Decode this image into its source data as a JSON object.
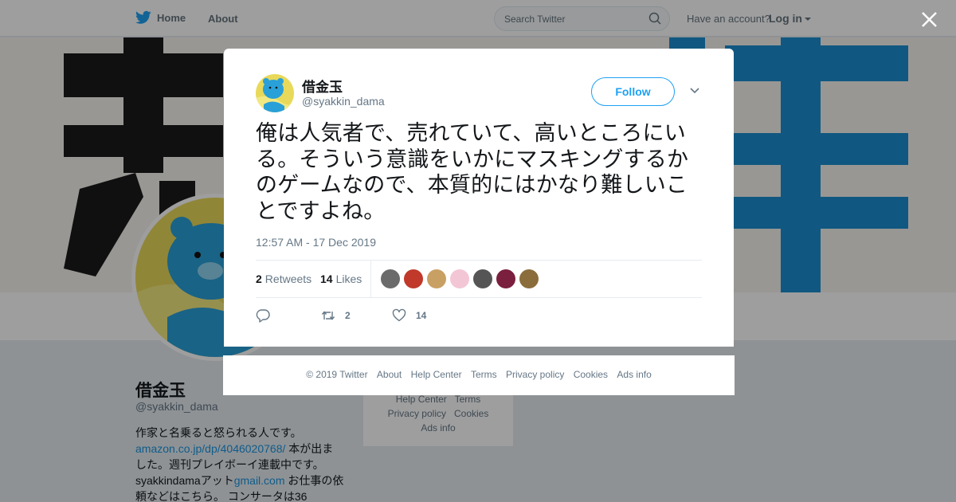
{
  "topbar": {
    "home_label": "Home",
    "about_label": "About",
    "search_placeholder": "Search Twitter",
    "have_account": "Have an account?",
    "login_label": "Log in"
  },
  "profile": {
    "name": "借金玉",
    "handle": "@syakkin_dama",
    "bio_1": "作家と名乗ると怒られる人です。",
    "bio_link_1": "amazon.co.jp/dp/4046020768/",
    "bio_2": " 本が出ました。週刊プレイボーイ連載中です。 syakkindamaアット",
    "bio_link_2": "gmail.com",
    "bio_3": " お仕事の依頼などはこちら。 コンサータは36"
  },
  "side_links": {
    "help_center": "Help Center",
    "terms": "Terms",
    "privacy": "Privacy policy",
    "cookies": "Cookies",
    "ads": "Ads info"
  },
  "tweet": {
    "name": "借金玉",
    "handle": "@syakkin_dama",
    "follow_label": "Follow",
    "text": "俺は人気者で、売れていて、高いところにいる。そういう意識をいかにマスキングするかのゲームなので、本質的にはかなり難しいことですよね。",
    "timestamp": "12:57 AM - 17 Dec 2019",
    "retweet_count": "2",
    "retweet_label": "Retweets",
    "like_count": "14",
    "like_label": "Likes",
    "action_retweets": "2",
    "action_likes": "14",
    "liker_colors": [
      "#6b6b6b",
      "#c0392b",
      "#c9a063",
      "#f3c6d6",
      "#555555",
      "#7a1f3d",
      "#8a6d3b"
    ]
  },
  "footer": {
    "copyright": "© 2019 Twitter",
    "about": "About",
    "help_center": "Help Center",
    "terms": "Terms",
    "privacy": "Privacy policy",
    "cookies": "Cookies",
    "ads": "Ads info"
  },
  "colors": {
    "twitter_blue": "#1da1f2",
    "link_blue": "#1b95e0",
    "muted_gray": "#657786"
  }
}
